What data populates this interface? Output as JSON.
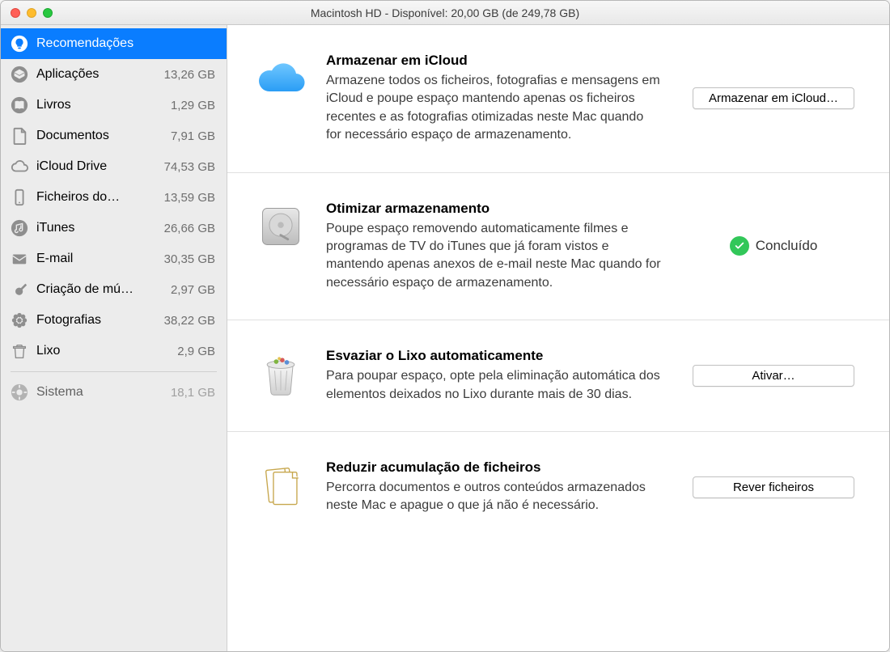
{
  "titlebar": {
    "title": "Macintosh HD - Disponível: 20,00 GB (de 249,78 GB)"
  },
  "sidebar": {
    "items": [
      {
        "label": "Recomendações",
        "size": "",
        "icon": "lightbulb",
        "selected": true
      },
      {
        "label": "Aplicações",
        "size": "13,26 GB",
        "icon": "app"
      },
      {
        "label": "Livros",
        "size": "1,29 GB",
        "icon": "book"
      },
      {
        "label": "Documentos",
        "size": "7,91 GB",
        "icon": "doc"
      },
      {
        "label": "iCloud Drive",
        "size": "74,53 GB",
        "icon": "cloud"
      },
      {
        "label": "Ficheiros do…",
        "size": "13,59 GB",
        "icon": "phone"
      },
      {
        "label": "iTunes",
        "size": "26,66 GB",
        "icon": "music-note"
      },
      {
        "label": "E-mail",
        "size": "30,35 GB",
        "icon": "envelope"
      },
      {
        "label": "Criação de mú…",
        "size": "2,97 GB",
        "icon": "guitar"
      },
      {
        "label": "Fotografias",
        "size": "38,22 GB",
        "icon": "flower"
      },
      {
        "label": "Lixo",
        "size": "2,9 GB",
        "icon": "trash"
      },
      {
        "label": "Sistema",
        "size": "18,1 GB",
        "icon": "gear",
        "muted": true,
        "divider_before": true
      }
    ]
  },
  "recommendations": [
    {
      "icon": "icloud",
      "title": "Armazenar em iCloud",
      "desc": "Armazene todos os ficheiros, fotografias e mensagens em iCloud e poupe espaço mantendo apenas os ficheiros recentes e as fotografias otimizadas neste Mac quando for necessário espaço de armazenamento.",
      "button": "Armazenar em iCloud…"
    },
    {
      "icon": "hdd",
      "title": "Otimizar armazenamento",
      "desc": "Poupe espaço removendo automaticamente filmes e programas de TV do iTunes que já foram vistos e mantendo apenas anexos de e-mail neste Mac quando for necessário espaço de armazenamento.",
      "status": "Concluído"
    },
    {
      "icon": "trash-full",
      "title": "Esvaziar o Lixo automaticamente",
      "desc": "Para poupar espaço, opte pela eliminação automática dos elementos deixados no Lixo durante mais de 30 dias.",
      "button": "Ativar…"
    },
    {
      "icon": "docs",
      "title": "Reduzir acumulação de ficheiros",
      "desc": "Percorra documentos e outros conteúdos armazenados neste Mac e apague o que já não é necessário.",
      "button": "Rever ficheiros"
    }
  ]
}
